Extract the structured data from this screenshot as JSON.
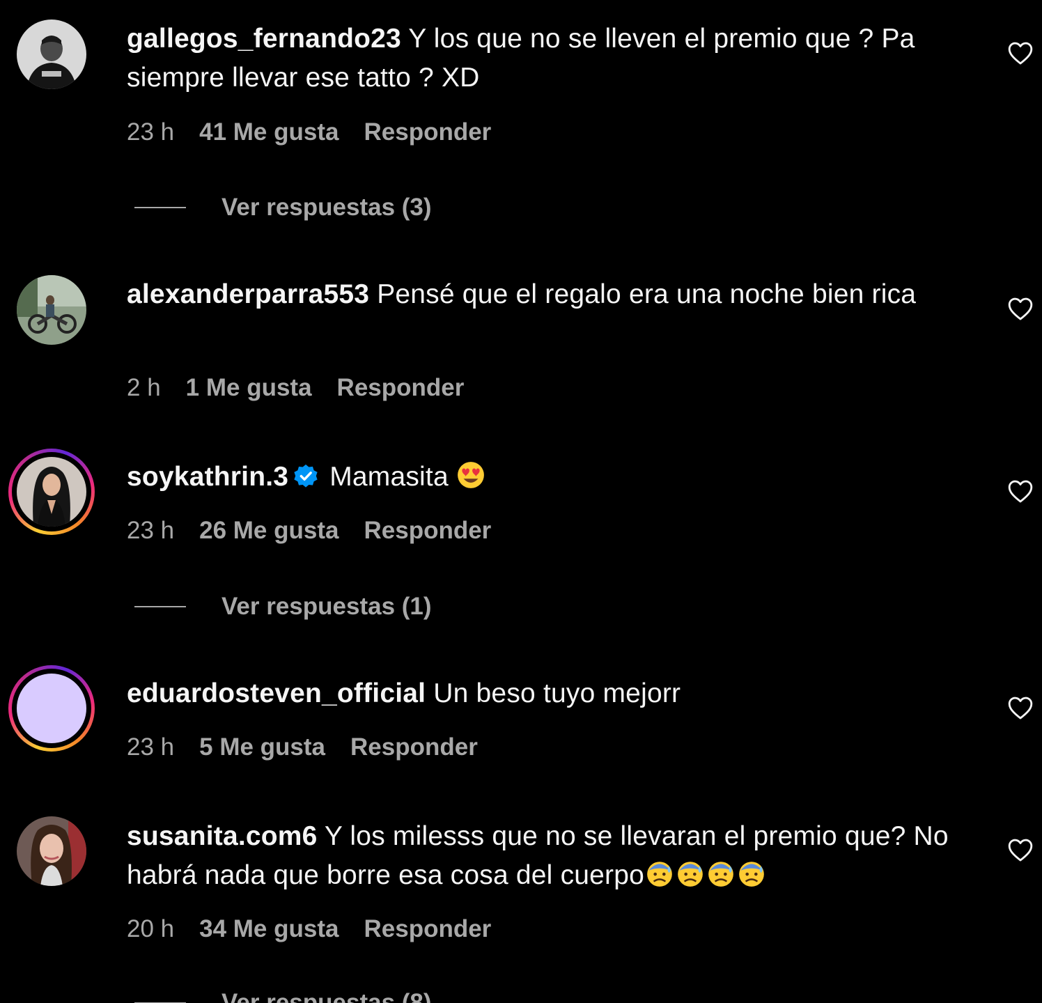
{
  "comments": [
    {
      "username": "gallegos_fernando23",
      "text": "Y los que no se lleven el premio que ? Pa siempre llevar ese tatto ? XD",
      "time": "23 h",
      "likes": "41 Me gusta",
      "reply": "Responder",
      "view_replies": "Ver respuestas (3)"
    },
    {
      "username": "alexanderparra553",
      "text": "Pensé que el regalo era una noche bien rica",
      "time": "2 h",
      "likes": "1 Me gusta",
      "reply": "Responder"
    },
    {
      "username": "soykathrin.3",
      "text": "Mamasita",
      "time": "23 h",
      "likes": "26 Me gusta",
      "reply": "Responder",
      "view_replies": "Ver respuestas (1)"
    },
    {
      "username": "eduardosteven_official",
      "text": "Un beso tuyo mejorr",
      "time": "23 h",
      "likes": "5 Me gusta",
      "reply": "Responder"
    },
    {
      "username": "susanita.com6",
      "text": "Y los milesss que no se llevaran el premio que? No habrá nada que borre esa cosa del cuerpo",
      "time": "20 h",
      "likes": "34 Me gusta",
      "reply": "Responder",
      "view_replies": "Ver respuestas (8)"
    }
  ],
  "icons": {
    "like": "heart-outline-icon",
    "verified": "verified-badge-icon",
    "emoji_heart_eyes": "heart-eyes-emoji",
    "emoji_anxious": "anxious-sweat-emoji"
  },
  "colors": {
    "background": "#000000",
    "text": "#f5f5f5",
    "secondary": "#a8a8a8",
    "verified": "#0095f6",
    "story_ring": "#ee2a7b",
    "default_avatar": "#d9cbff"
  }
}
